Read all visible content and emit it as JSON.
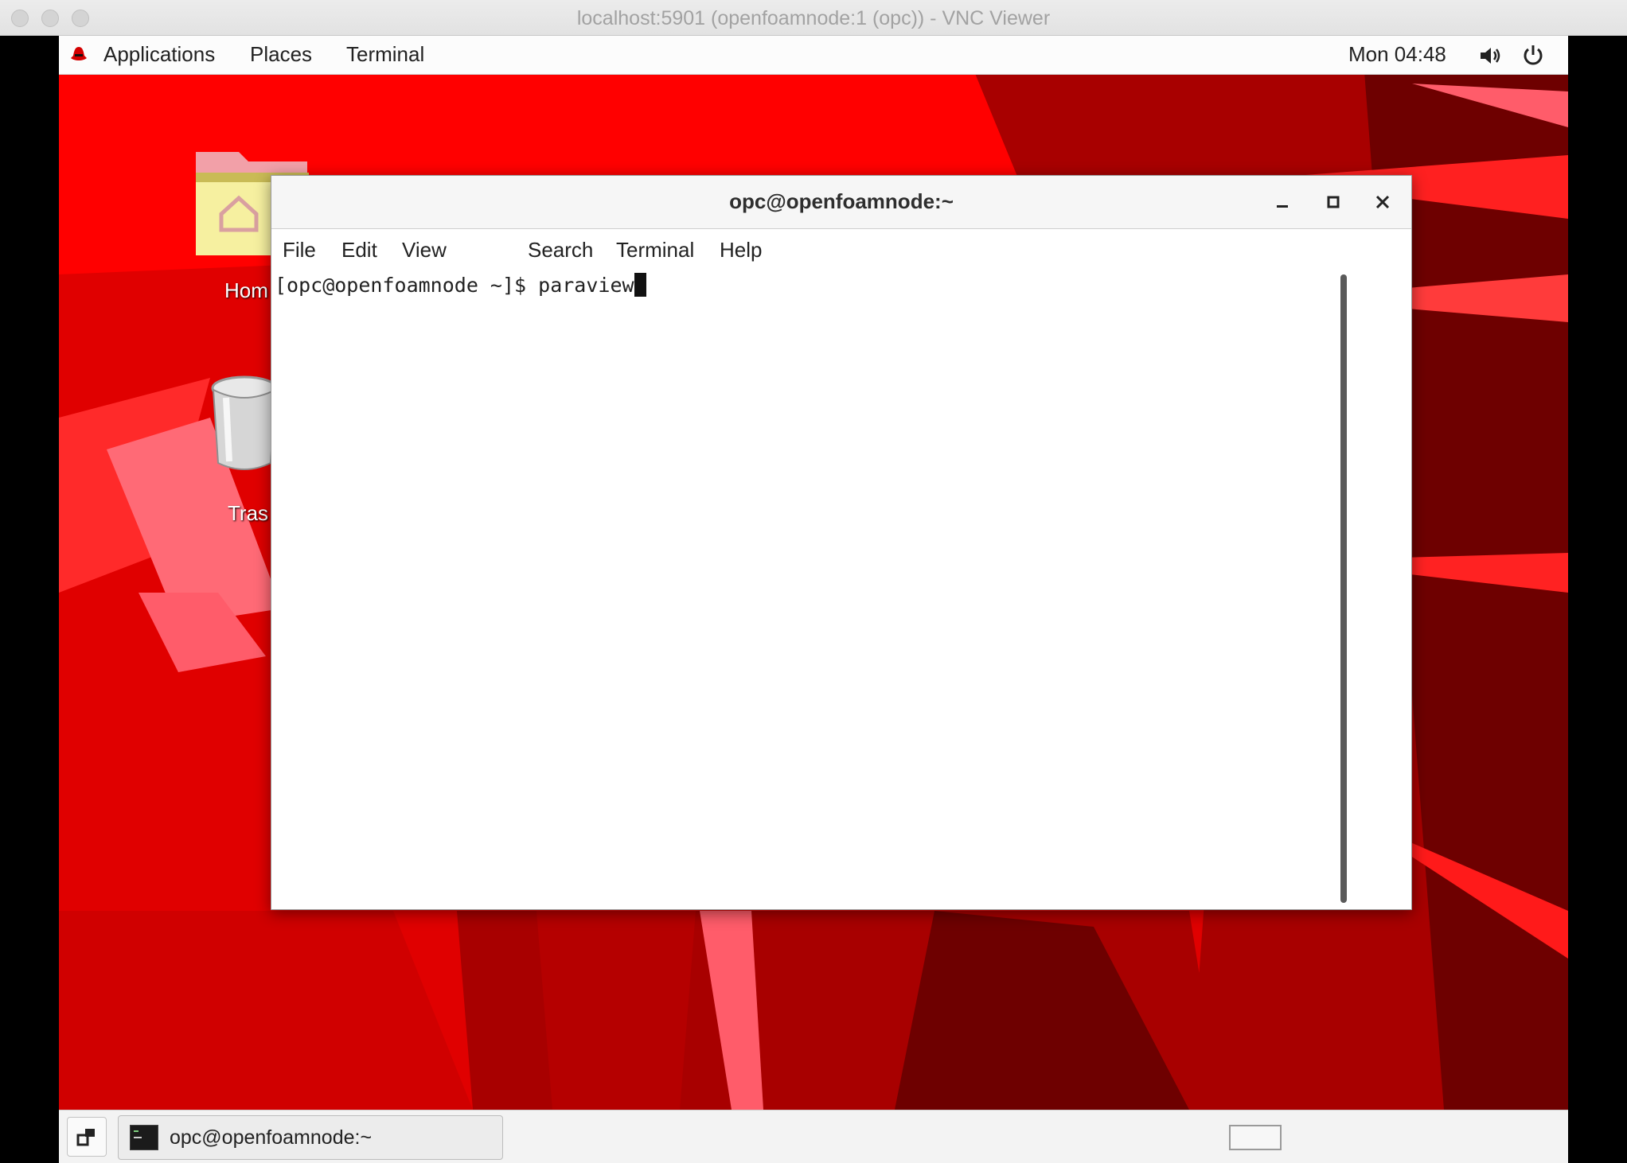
{
  "viewer": {
    "title": "localhost:5901 (openfoamnode:1 (opc)) - VNC Viewer"
  },
  "topbar": {
    "applications": "Applications",
    "places": "Places",
    "terminal": "Terminal",
    "clock": "Mon 04:48",
    "volume_icon": "speaker-icon",
    "power_icon": "power-icon"
  },
  "desktop_icons": [
    {
      "label": "Hom",
      "icon": "home-folder-icon"
    },
    {
      "label": "Tras",
      "icon": "trash-icon"
    }
  ],
  "terminal_window": {
    "title": "opc@openfoamnode:~",
    "menu": [
      "File",
      "Edit",
      "View",
      "Search",
      "Terminal",
      "Help"
    ],
    "prompt": "[opc@openfoamnode ~]$ ",
    "command": "paraview"
  },
  "taskbar": {
    "task_label": "opc@openfoamnode:~"
  },
  "colors": {
    "wallpaper_bright": "#ff0000",
    "wallpaper_mid": "#e00000",
    "wallpaper_dark": "#a80000",
    "wallpaper_darkest": "#6e0000",
    "wallpaper_pink": "#ff5c6a"
  }
}
